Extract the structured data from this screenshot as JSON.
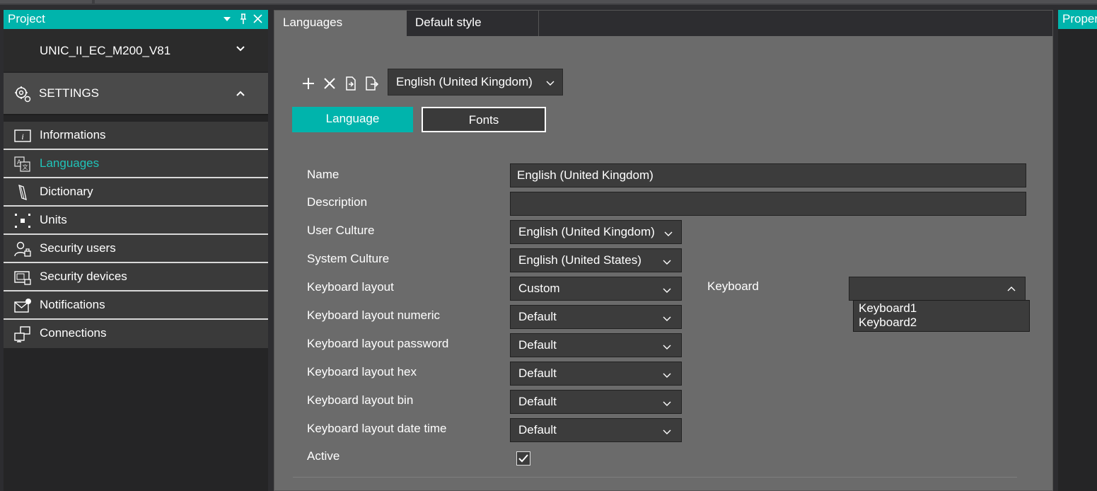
{
  "project_panel": {
    "title": "Project",
    "project_name": "UNIC_II_EC_M200_V81",
    "settings_label": "SETTINGS",
    "nav_items": [
      {
        "label": "Informations",
        "icon": "info-icon"
      },
      {
        "label": "Languages",
        "icon": "languages-icon",
        "active": true
      },
      {
        "label": "Dictionary",
        "icon": "dictionary-icon"
      },
      {
        "label": "Units",
        "icon": "units-icon"
      },
      {
        "label": "Security users",
        "icon": "security-users-icon"
      },
      {
        "label": "Security devices",
        "icon": "security-devices-icon"
      },
      {
        "label": "Notifications",
        "icon": "notifications-icon"
      },
      {
        "label": "Connections",
        "icon": "connections-icon"
      }
    ]
  },
  "tabs": [
    {
      "label": "Languages",
      "active": true
    },
    {
      "label": "Default style",
      "active": false
    }
  ],
  "toolbar": {
    "language_select": "English (United Kingdom)"
  },
  "subtabs": {
    "language": "Language",
    "fonts": "Fonts"
  },
  "form": {
    "name_label": "Name",
    "name_value": "English (United Kingdom)",
    "description_label": "Description",
    "description_value": "",
    "user_culture_label": "User Culture",
    "user_culture_value": "English (United Kingdom)",
    "system_culture_label": "System Culture",
    "system_culture_value": "English (United States)",
    "keyboard_layout_label": "Keyboard layout",
    "keyboard_layout_value": "Custom",
    "keyboard_layout_numeric_label": "Keyboard layout numeric",
    "keyboard_layout_numeric_value": "Default",
    "keyboard_layout_password_label": "Keyboard layout password",
    "keyboard_layout_password_value": "Default",
    "keyboard_layout_hex_label": "Keyboard layout hex",
    "keyboard_layout_hex_value": "Default",
    "keyboard_layout_bin_label": "Keyboard layout bin",
    "keyboard_layout_bin_value": "Default",
    "keyboard_layout_datetime_label": "Keyboard layout date time",
    "keyboard_layout_datetime_value": "Default",
    "active_label": "Active",
    "active_checked": true,
    "keyboard_label": "Keyboard",
    "keyboard_value": "",
    "keyboard_options": [
      "Keyboard1",
      "Keyboard2"
    ]
  },
  "properties_panel": {
    "title": "Properties"
  },
  "colors": {
    "accent": "#00b4ac",
    "active_nav_text": "#20c3b8"
  }
}
